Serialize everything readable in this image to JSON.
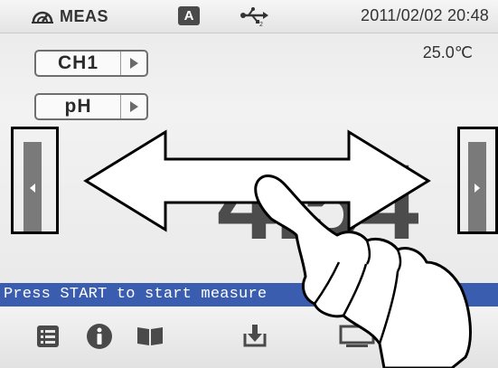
{
  "status_bar": {
    "mode_icon": "measure-gauge-icon",
    "mode_label": "MEAS",
    "auto_badge": "A",
    "usb_icon": "usb-icon",
    "datetime": "2011/02/02 20:48"
  },
  "temperature": "25.0℃",
  "channel_selector": {
    "label": "CH1",
    "arrow_icon": "triangle-right-icon"
  },
  "parameter_selector": {
    "label": "pH",
    "arrow_icon": "triangle-right-icon"
  },
  "reading": "4.54",
  "navigation": {
    "left_icon": "triangle-left-icon",
    "right_icon": "triangle-right-icon"
  },
  "message": "Press START to start measure",
  "bottom_bar": {
    "icons": [
      "list-icon",
      "info-icon",
      "book-icon",
      "save-download-icon",
      "monitor-icon"
    ]
  },
  "overlay": {
    "gesture": "swipe-gesture-hand-icon",
    "arrow": "double-arrow-icon"
  },
  "colors": {
    "message_bar": "#3b5db0",
    "reading": "#4c4c4c",
    "nav_tab": "#7a7a7a"
  }
}
